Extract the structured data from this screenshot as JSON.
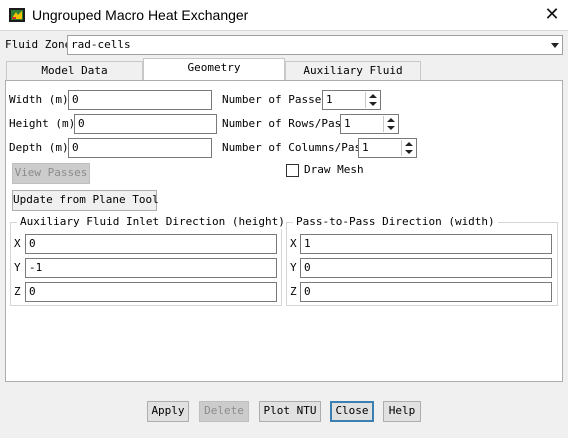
{
  "window": {
    "title": "Ungrouped Macro Heat Exchanger",
    "icon": "fluent-app-icon",
    "close_icon": "close-icon",
    "close_glyph": "✕"
  },
  "fluid_zone": {
    "label": "Fluid Zone",
    "value": "rad-cells"
  },
  "tabs": [
    {
      "label": "Model Data",
      "active": false
    },
    {
      "label": "Geometry",
      "active": true
    },
    {
      "label": "Auxiliary Fluid",
      "active": false
    }
  ],
  "geometry": {
    "width": {
      "label": "Width (m)",
      "value": "0"
    },
    "height": {
      "label": "Height (m)",
      "value": "0"
    },
    "depth": {
      "label": "Depth (m)",
      "value": "0"
    },
    "passes": {
      "label": "Number of Passes",
      "value": "1"
    },
    "rows": {
      "label": "Number of Rows/Pass",
      "value": "1"
    },
    "columns": {
      "label": "Number of Columns/Pass",
      "value": "1"
    },
    "view_passes": "View Passes",
    "draw_mesh": {
      "label": "Draw Mesh",
      "checked": false
    },
    "update_from_plane": "Update from Plane Tool"
  },
  "aux_inlet": {
    "title": "Auxiliary Fluid Inlet Direction (height)",
    "x": {
      "label": "X",
      "value": "0"
    },
    "y": {
      "label": "Y",
      "value": "-1"
    },
    "z": {
      "label": "Z",
      "value": "0"
    }
  },
  "pass_to_pass": {
    "title": "Pass-to-Pass Direction (width)",
    "x": {
      "label": "X",
      "value": "1"
    },
    "y": {
      "label": "Y",
      "value": "0"
    },
    "z": {
      "label": "Z",
      "value": "0"
    }
  },
  "buttons": {
    "apply": "Apply",
    "delete": "Delete",
    "plot_ntu": "Plot NTU",
    "close": "Close",
    "help": "Help"
  },
  "colors": {
    "focus_border": "#3c7fb1",
    "window_bg": "#f0f0f0",
    "panel_bg": "#ffffff"
  }
}
